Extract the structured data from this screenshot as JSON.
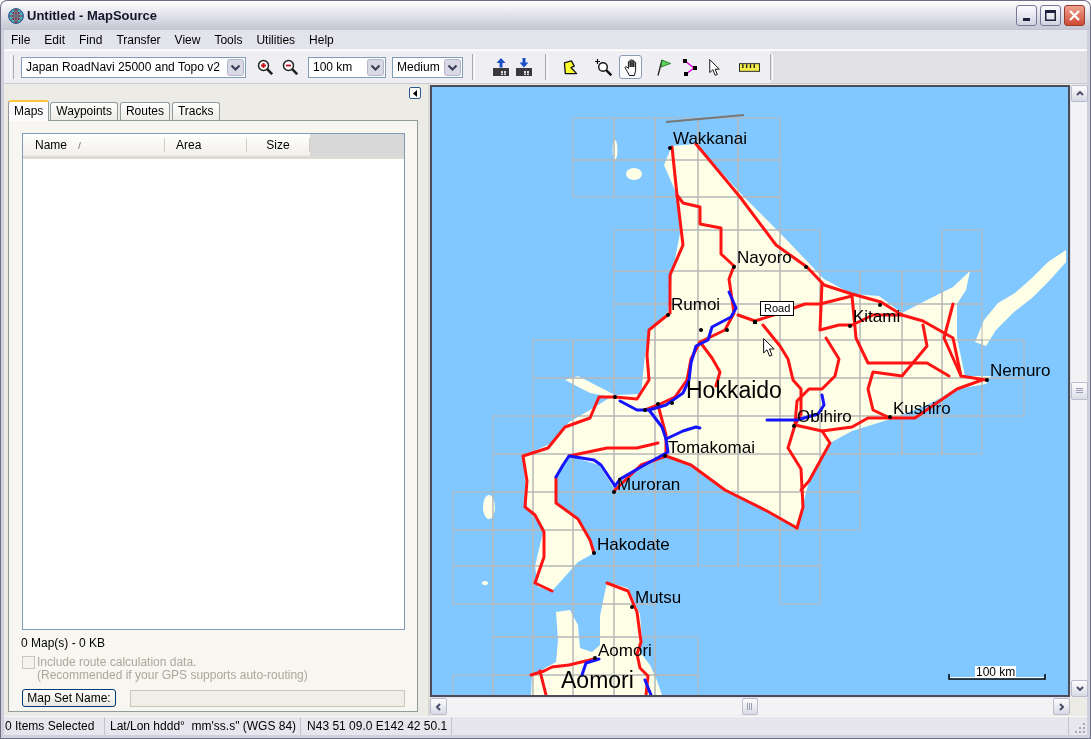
{
  "window": {
    "title": "Untitled - MapSource"
  },
  "menu": [
    "File",
    "Edit",
    "Find",
    "Transfer",
    "View",
    "Tools",
    "Utilities",
    "Help"
  ],
  "toolbar": {
    "items": [
      {
        "kind": "dropdown",
        "value": "Japan RoadNavi 25000 and Topo v2"
      },
      {
        "kind": "zoom_in"
      },
      {
        "kind": "zoom_out"
      },
      {
        "kind": "dropdown",
        "value": "100 km"
      },
      {
        "kind": "dropdown",
        "value": "Medium"
      },
      {
        "kind": "separator"
      },
      {
        "kind": "send"
      },
      {
        "kind": "receive"
      },
      {
        "kind": "separator"
      },
      {
        "kind": "area_tool",
        "selected": false
      },
      {
        "kind": "zoom_tool",
        "selected": false
      },
      {
        "kind": "hand_tool",
        "selected": true
      },
      {
        "kind": "waypoint_tool",
        "selected": false
      },
      {
        "kind": "route_tool",
        "selected": false
      },
      {
        "kind": "select_tool",
        "selected": false
      },
      {
        "kind": "distance_tool",
        "selected": false
      },
      {
        "kind": "separator"
      }
    ]
  },
  "sidebar": {
    "tabs": [
      {
        "label": "Maps",
        "selected": true
      },
      {
        "label": "Waypoints",
        "selected": false
      },
      {
        "label": "Routes",
        "selected": false
      },
      {
        "label": "Tracks",
        "selected": false
      }
    ],
    "columns": [
      {
        "label": "Name",
        "sorted": true
      },
      {
        "label": "Area",
        "sorted": false
      },
      {
        "label": "Size",
        "sorted": false
      }
    ],
    "summary": "0 Map(s) - 0 KB",
    "route_data": {
      "label": "Include route calculation data.",
      "note": "(Recommended if your GPS supports auto-routing)",
      "checked": false,
      "disabled": true
    },
    "map_set": {
      "button": "Map Set Name:",
      "disabled": true
    }
  },
  "map": {
    "places": [
      {
        "name": "Wakkanai",
        "kind": "city"
      },
      {
        "name": "Nayoro",
        "kind": "city"
      },
      {
        "name": "Rumoi",
        "kind": "city"
      },
      {
        "name": "Kitami",
        "kind": "city"
      },
      {
        "name": "Nemuro",
        "kind": "city"
      },
      {
        "name": "Hokkaido",
        "kind": "region"
      },
      {
        "name": "Obihiro",
        "kind": "city"
      },
      {
        "name": "Kushiro",
        "kind": "city"
      },
      {
        "name": "Tomakomai",
        "kind": "city"
      },
      {
        "name": "Muroran",
        "kind": "city"
      },
      {
        "name": "Hakodate",
        "kind": "city"
      },
      {
        "name": "Mutsu",
        "kind": "city"
      },
      {
        "name": "Aomori",
        "kind": "city"
      },
      {
        "name": "Aomori",
        "kind": "region"
      }
    ],
    "pointer_label": "Road",
    "scale": "100 km"
  },
  "status_bar": [
    "0 Items Selected",
    "Lat/Lon hddd°  mm'ss.s\" (WGS 84)",
    "N43 51 09.0 E142 42 50.1"
  ]
}
